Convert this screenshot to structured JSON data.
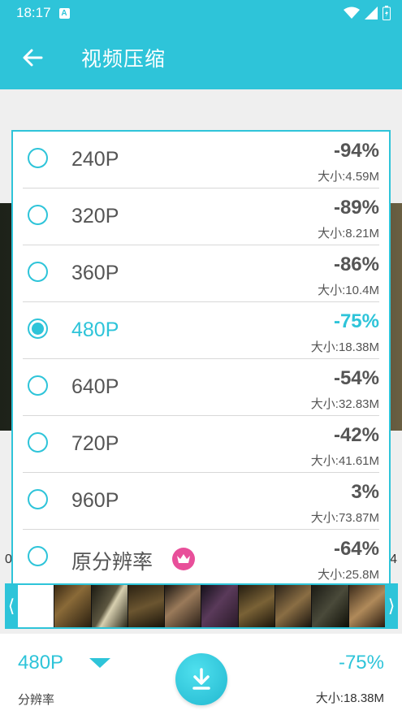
{
  "status_bar": {
    "time": "18:17",
    "notification_icon": "A"
  },
  "app_bar": {
    "title": "视频压缩",
    "back_icon": "arrow-left-icon"
  },
  "timeline": {
    "left_label": "0",
    "right_label": "4"
  },
  "popup": {
    "options": [
      {
        "label": "240P",
        "percent": "-94%",
        "size": "大小:4.59M",
        "selected": false
      },
      {
        "label": "320P",
        "percent": "-89%",
        "size": "大小:8.21M",
        "selected": false
      },
      {
        "label": "360P",
        "percent": "-86%",
        "size": "大小:10.4M",
        "selected": false
      },
      {
        "label": "480P",
        "percent": "-75%",
        "size": "大小:18.38M",
        "selected": true
      },
      {
        "label": "640P",
        "percent": "-54%",
        "size": "大小:32.83M",
        "selected": false
      },
      {
        "label": "720P",
        "percent": "-42%",
        "size": "大小:41.61M",
        "selected": false
      },
      {
        "label": "960P",
        "percent": "3%",
        "size": "大小:73.87M",
        "selected": false
      },
      {
        "label": "原分辨率",
        "percent": "-64%",
        "size": "大小:25.8M",
        "selected": false,
        "badge": "crown-icon"
      }
    ]
  },
  "bottom": {
    "resolution_value": "480P",
    "resolution_label": "分辨率",
    "percent": "-75%",
    "size": "大小:18.38M"
  },
  "colors": {
    "accent": "#2ec4d9",
    "badge": "#e84f9a"
  }
}
